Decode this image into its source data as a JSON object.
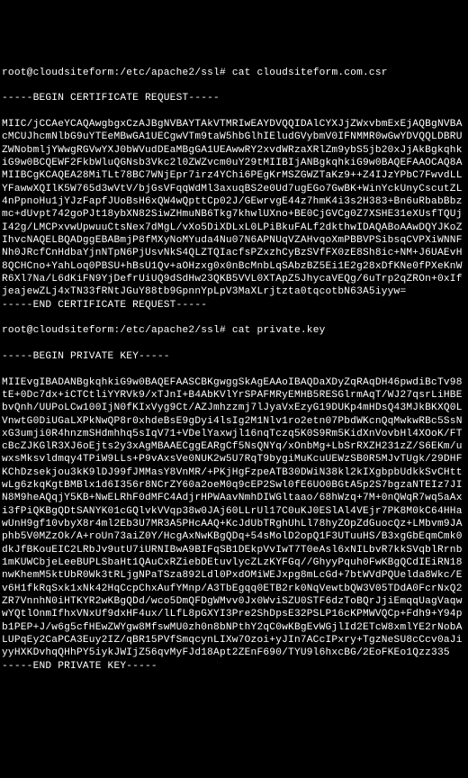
{
  "prompt1_user": "root@cloudsiteform",
  "prompt1_path": "/etc/apache2/ssl#",
  "cmd1": "cat cloudsiteform.com.csr",
  "csr_begin": "-----BEGIN CERTIFICATE REQUEST-----",
  "csr_body": "MIIC/jCCAeYCAQAwgbgxCzAJBgNVBAYTAkVTMRIwEAYDVQQIDAlCYXJjZWxvbmExEjAQBgNVBAcMCUJhcmNlbG9uYTEeMBwGA1UECgwVTm9taW5hbGlhIEludGVybmV0IFNMMR0wGwYDVQQLDBRUZWNobmljYWwgRGVwYXJ0bWVudDEaMBgGA1UEAwwRY2xvdWRzaXRlZm9ybS5jb20xJjAkBgkqhkiG9w0BCQEWF2FkbWluQGNsb3Vkc2l0ZWZvcm0uY29tMIIBIjANBgkqhkiG9w0BAQEFAAOCAQ8AMIIBCgKCAQEA28MiTLt78BC7WNjEpr7irz4YChi6PEgKrMSZGWZTaKz9++Z4IJzYPbC7FwvdLLYFawwXQIlK5W765d3wVtV/bjGsVFqqWdMl3axuqBS2e0Ud7ugEGo7GwBK+WinYckUnyCscutZL4nPpnoHu1jYJzFapfJUoBsH6xQW4wQpttCp02J/GEwrvgE44z7hmK4i3s2H383+Bn6uRbabBbzmc+dUvpt742goPJt18ybXN82SiwZHmuNB6Tkg7khwlUXno+BE0CjGVCg0Z7XSHE31eXUsfTQUjI42g/LMCPxvwUpwuuCtsNex7dMgL/vXo5DiXDLxL0LPiBkuFALf2dkthwIDAQABoAAwDQYJKoZIhvcNAQELBQADggEBABmjP8fMXyNoMYuda4Nu07N6APNUqVZAHvqoXmPBBVPSibsqCVPXiWNNFNh0JRcfCnHdbaYjnNTpN6PjUsvNkS4QLZTQIacfsPZxzhCyBzSVfFX0zE8Sh8ic+NM+J6UAEvH8QCHCno+YahLoq0PBSU+hBsU1Qv+aOHzxg0x0nBcMnbLqSAbzBZ5Ei1E2g28xDfKNe0fPXeKnWR6Xl7Na/L6dKiFN9YjDefrUiUQ9dSdHw23QKB5VVL0XTApZ5JhycaVEQg/6uTrp2qZROn+0xIfjeajewZLj4xTN33fRNtJGuY88tb9GpnnYpLpV3MaXLrjtzta0tqcotbN63A5iyyw=",
  "csr_end": "-----END CERTIFICATE REQUEST-----",
  "prompt2_user": "root@cloudsiteform",
  "prompt2_path": "/etc/apache2/ssl#",
  "cmd2": "cat private.key",
  "key_begin": "-----BEGIN PRIVATE KEY-----",
  "key_body": "MIIEvgIBADANBgkqhkiG9w0BAQEFAASCBKgwggSkAgEAAoIBAQDaXDyZqRAqDH46pwdiBcTv98tE+0Dc7dx+iCTCtliYYRVk9/xTJnI+B4AbKVlYrSPAFMRyEMHB5RESGlrmAqT/WJ27qsrLiHBEbvQnh/UUPoLCw100IjN0fKIxVyg9Ct/AZJmhzzmj7lJyaVxEzyG19DUKp4mHDsQ43MJkBKXQ0LVnwtG0DiUGaLXPkNwQP8r0xhdeBsE9gDyi4lsIg2M1Nlv1ro2etn07PbdWKcnQqMwkwRBc5SsNxG3umji0R4hnzmSHdmhhq5sIqV71+VDelYaxwjl16nqTczq5K0S9Rm5KidXnVovbHl4XOoK/FTcBcZJKGlR3XJ6oEjts2y3xAgMBAAECggEARgCf5NsQNYq/xOnbMg+LbSrRXZH231zZ/S6EKm/uwxsMksvldmqy4TPiW9LLs+P9vAxsVe0NUK2w5U7RqT9bygiMuKcuUEWzSB0R5MJvTUgk/29DHFKChDzsekjou3kK9lDJ99fJMMasY8VnMR/+PKjHgFzpeATB30DWiN38kl2kIXgbpbUdkkSvCHttwLg6zkqKgtBMBlx1d6I356r8NCrZY60a2oeM0q9cEP2Swl0fE6UO0BGtA5p2S7bgzaNTEIz7JIN8M9heAQqjY5KB+NwELRhF0dMFC4AdjrHPWAavNmhDIWGltaao/68hWzq+7M+0nQWqR7wq5aAxi3fPiQKBgQDtSANYK01cGQlvkVVqp38w0JAj60LLrUl17C0uKJ0ESlAl4VEjr7PK8M0kC64HHawUnH9gf10vbyX8r4ml2Eb3U7MR3A5PHcAAQ+KcJdUbTRghUhLl78hyZOpZdGuocQz+LMbvm9JAphb5V0MZzOk/A+roUn73aiZ0Y/HcgAxNwKBgQDq+54sMolD2opQ1F3UTuuHS/B3xgGbEqmCmk0dkJfBKouEIC2LRbJv9utU7iURNIBwA9BIFqSB1DEkpVvIwT7T0eAsl6xNILbvR7kkSVqblRrnb1mKUWCbjeLeeBUPLSbaHt1QAuCxRZiebDEtuvlycZLzKYFGq//GhyyPquh0FwKBgQCdIEiRN18nwKhemM5ktUbR0Wk3tRLjgNPaTSza892Ldl0PxdOMiWEJxpg8mLcGd+7btWVdPQUelda8Wkc/Ev6H1fkRqSxk1xNk42HqCcpChxAufYMnp/A3TbEgqq0ETB2rk0NqVewtbQW3V05TDdA0FcrNxQ2ZR7VnnhN0iHTKYR2wKBgQDd/wco5DmQFDgWMvv0Jx0WviSZU0STF6dzToBQrJjiEmqqUagVaqwwYQtlOnmIfhxVNxUf9dxHF4ux/lLfL8pGXYI3Pre2ShDpsE32PSLP16cKPMWVQCp+Fdh9+Y94pb1PEP+J/w6g5cfHEwZWYgw8MfswMU0zh0n8bNPthY2qC0wKBgEvWGjlId2ETcW8xmlYE2rNobALUPqEy2CaPCA3Euy2IZ/qBR15PVfSmqcynLIXw7Ozoi+yJIn7ACcIPxry+TgzNeSU8cCcv0aJiyyHXKDvhqQHhPY5iykJWIjZ56qvMyFJd18Apt2ZEnF690/TYU9l6hxcBG/2EoFKEo1Qzz335",
  "key_end": "-----END PRIVATE KEY-----"
}
